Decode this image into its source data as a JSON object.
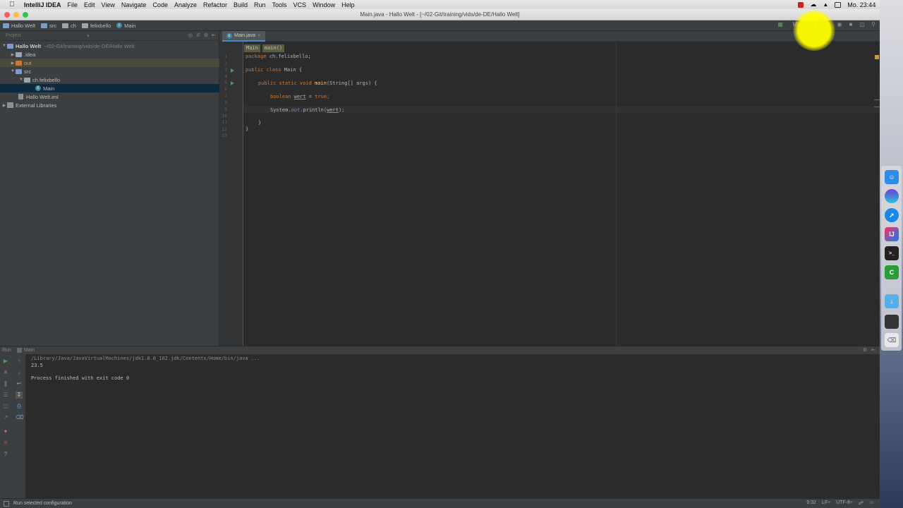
{
  "menubar": {
    "app": "IntelliJ IDEA",
    "items": [
      "File",
      "Edit",
      "View",
      "Navigate",
      "Code",
      "Analyze",
      "Refactor",
      "Build",
      "Run",
      "Tools",
      "VCS",
      "Window",
      "Help"
    ],
    "clock": "Mo. 23:44"
  },
  "window": {
    "title": "Main.java - Hallo Welt - [~/02-Git/training/vids/de-DE/Hallo Welt]"
  },
  "navbar": {
    "crumbs": [
      "Hallo Welt",
      "src",
      "ch",
      "felixbello",
      "Main"
    ],
    "run_config": "Main"
  },
  "project": {
    "header": "Project",
    "tree": [
      {
        "label": "Hallo Welt",
        "extra": "~/02-Git/training/vids/de-DE/Hallo Welt"
      },
      {
        "label": ".idea"
      },
      {
        "label": "out"
      },
      {
        "label": "src"
      },
      {
        "label": "ch.felixbello"
      },
      {
        "label": "Main"
      },
      {
        "label": "Hallo Welt.iml"
      },
      {
        "label": "External Libraries"
      }
    ]
  },
  "editor": {
    "tab": "Main.java",
    "breadcrumb": [
      "Main",
      "main()"
    ],
    "line_numbers": [
      "1",
      "2",
      "3",
      "4",
      "5",
      "6",
      "7",
      "8",
      "9",
      "10",
      "11",
      "12",
      "13"
    ],
    "code": {
      "l1_kw": "package",
      "l1_rest": " ch.felixbello;",
      "l3_kw": "public class",
      "l3_rest": " Main {",
      "l5_kw": "public static void",
      "l5_fn": "main",
      "l5_rest": "(String[] args) {",
      "l7_kw": "boolean",
      "l7_var": "wert",
      "l7_eq": " = ",
      "l7_val": "true",
      "l7_end": ";",
      "l9_a": "System.",
      "l9_fld": "out",
      "l9_b": ".println(",
      "l9_var": "wert",
      "l9_c": ");",
      "l11": "}",
      "l12": "}"
    }
  },
  "run": {
    "tab": "Run",
    "config": "Main",
    "console": [
      "/Library/Java/JavaVirtualMachines/jdk1.8.0_102.jdk/Contents/Home/bin/java ...",
      "23.5",
      "",
      "Process finished with exit code 0"
    ]
  },
  "status": {
    "message": "Run selected configuration",
    "position": "9:32",
    "line_sep": "LF÷",
    "encoding": "UTF-8÷"
  },
  "colors": {
    "bg": "#2b2b2b",
    "panel": "#3c3f41",
    "keyword": "#cc7832",
    "method": "#ffc66d",
    "field": "#9876aa",
    "selection": "#0d293e"
  }
}
